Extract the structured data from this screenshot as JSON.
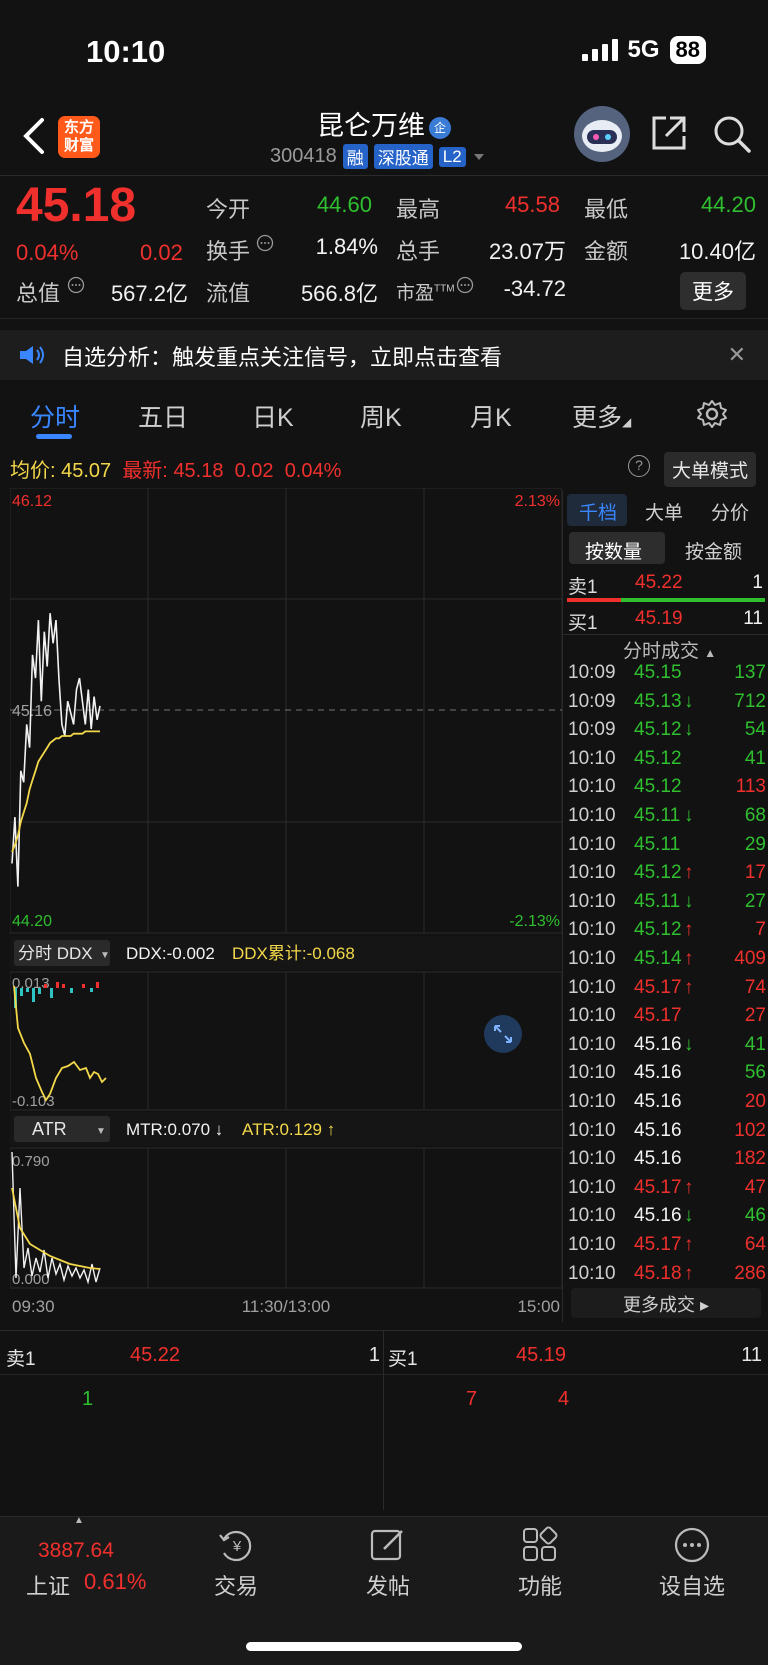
{
  "status_bar": {
    "time": "10:10",
    "network": "5G",
    "battery": "88"
  },
  "header": {
    "logo_text": "东方财富",
    "stock_name": "昆仑万维",
    "name_badge": "企",
    "stock_code": "300418",
    "tags": [
      "融",
      "深股通",
      "L2"
    ]
  },
  "quote": {
    "price": "45.18",
    "change_pct": "0.04%",
    "change_abs": "0.02",
    "fields": [
      {
        "label": "今开",
        "value": "44.60",
        "color": "green"
      },
      {
        "label": "最高",
        "value": "45.58",
        "color": "red"
      },
      {
        "label": "最低",
        "value": "44.20",
        "color": "green"
      },
      {
        "label": "换手",
        "value": "1.84%",
        "color": "white"
      },
      {
        "label": "总手",
        "value": "23.07万",
        "color": "white"
      },
      {
        "label": "金额",
        "value": "10.40亿",
        "color": "white"
      },
      {
        "label": "总值",
        "value": "567.2亿",
        "color": "white"
      },
      {
        "label": "流值",
        "value": "566.8亿",
        "color": "white"
      },
      {
        "label": "市盈",
        "value": "-34.72",
        "color": "white"
      }
    ],
    "pe_superscript": "TTM",
    "more_label": "更多"
  },
  "notice": {
    "text": "自选分析：触发重点关注信号，立即点击查看"
  },
  "tabs": [
    "分时",
    "五日",
    "日K",
    "周K",
    "月K",
    "更多"
  ],
  "avg_row": {
    "avg_label": "均价:",
    "avg_value": "45.07",
    "latest_label": "最新:",
    "latest_value": "45.18",
    "latest_chg": "0.02",
    "latest_pct": "0.04%",
    "big_order_btn": "大单模式"
  },
  "chart_labels": {
    "y_top": "46.12",
    "y_mid": "45.16",
    "y_bottom": "44.20",
    "pct_top": "2.13%",
    "pct_bottom": "-2.13%",
    "ddx_selector": "分时 DDX",
    "ddx_value": "DDX:-0.002",
    "ddx_cum": "DDX累计:-0.068",
    "ddx_top": "0.013",
    "ddx_bottom": "-0.103",
    "atr_selector": "ATR",
    "mtr_value": "MTR:0.070 ↓",
    "atr_value": "ATR:0.129 ↑",
    "atr_top": "0.790",
    "atr_bottom": "0.000",
    "t_start": "09:30",
    "t_mid": "11:30/13:00",
    "t_end": "15:00"
  },
  "chart_data": {
    "type": "line",
    "title": "",
    "xlabel": "",
    "ylabel": "",
    "ylim": [
      44.2,
      46.12
    ],
    "prev_close": 45.16,
    "x_range": [
      "09:30",
      "15:00"
    ],
    "series": [
      {
        "values": [
          44.5,
          44.7,
          44.4,
          44.9,
          44.85,
          45.1,
          45.0,
          45.4,
          45.3,
          45.55,
          45.2,
          45.5,
          45.35,
          45.58,
          45.45,
          45.55,
          45.3,
          45.1,
          45.05,
          45.2,
          45.15,
          45.1,
          45.25,
          45.3,
          45.2,
          45.1,
          45.25,
          45.08,
          45.22,
          45.12,
          45.18
        ]
      },
      {
        "values": [
          44.55,
          44.58,
          44.62,
          44.68,
          44.72,
          44.76,
          44.82,
          44.86,
          44.9,
          44.94,
          44.96,
          44.98,
          45.0,
          45.02,
          45.03,
          45.04,
          45.04,
          45.05,
          45.05,
          45.05,
          45.05,
          45.06,
          45.06,
          45.06,
          45.06,
          45.07,
          45.07,
          45.07,
          45.07,
          45.07,
          45.07
        ]
      }
    ]
  },
  "right_panel": {
    "tabs": [
      "千档",
      "大单",
      "分价"
    ],
    "sub_tabs": [
      "按数量",
      "按金额"
    ],
    "sell1": {
      "label": "卖1",
      "price": "45.22",
      "qty": "1"
    },
    "buy1": {
      "label": "买1",
      "price": "45.19",
      "qty": "11"
    },
    "ticks_header": "分时成交",
    "ticks": [
      {
        "time": "10:09",
        "price": "45.15",
        "arrow": "",
        "pc": "green",
        "vol": "137",
        "vc": "green"
      },
      {
        "time": "10:09",
        "price": "45.13",
        "arrow": "↓",
        "pc": "green",
        "vol": "712",
        "vc": "green"
      },
      {
        "time": "10:09",
        "price": "45.12",
        "arrow": "↓",
        "pc": "green",
        "vol": "54",
        "vc": "green"
      },
      {
        "time": "10:10",
        "price": "45.12",
        "arrow": "",
        "pc": "green",
        "vol": "41",
        "vc": "green"
      },
      {
        "time": "10:10",
        "price": "45.12",
        "arrow": "",
        "pc": "green",
        "vol": "113",
        "vc": "red"
      },
      {
        "time": "10:10",
        "price": "45.11",
        "arrow": "↓",
        "pc": "green",
        "vol": "68",
        "vc": "green"
      },
      {
        "time": "10:10",
        "price": "45.11",
        "arrow": "",
        "pc": "green",
        "vol": "29",
        "vc": "green"
      },
      {
        "time": "10:10",
        "price": "45.12",
        "arrow": "↑",
        "pc": "green",
        "vol": "17",
        "vc": "red"
      },
      {
        "time": "10:10",
        "price": "45.11",
        "arrow": "↓",
        "pc": "green",
        "vol": "27",
        "vc": "green"
      },
      {
        "time": "10:10",
        "price": "45.12",
        "arrow": "↑",
        "pc": "green",
        "vol": "7",
        "vc": "red"
      },
      {
        "time": "10:10",
        "price": "45.14",
        "arrow": "↑",
        "pc": "green",
        "vol": "409",
        "vc": "red"
      },
      {
        "time": "10:10",
        "price": "45.17",
        "arrow": "↑",
        "pc": "red",
        "vol": "74",
        "vc": "red"
      },
      {
        "time": "10:10",
        "price": "45.17",
        "arrow": "",
        "pc": "red",
        "vol": "27",
        "vc": "red"
      },
      {
        "time": "10:10",
        "price": "45.16",
        "arrow": "↓",
        "pc": "white",
        "vol": "41",
        "vc": "green"
      },
      {
        "time": "10:10",
        "price": "45.16",
        "arrow": "",
        "pc": "white",
        "vol": "56",
        "vc": "green"
      },
      {
        "time": "10:10",
        "price": "45.16",
        "arrow": "",
        "pc": "white",
        "vol": "20",
        "vc": "red"
      },
      {
        "time": "10:10",
        "price": "45.16",
        "arrow": "",
        "pc": "white",
        "vol": "102",
        "vc": "red"
      },
      {
        "time": "10:10",
        "price": "45.16",
        "arrow": "",
        "pc": "white",
        "vol": "182",
        "vc": "red"
      },
      {
        "time": "10:10",
        "price": "45.17",
        "arrow": "↑",
        "pc": "red",
        "vol": "47",
        "vc": "red"
      },
      {
        "time": "10:10",
        "price": "45.16",
        "arrow": "↓",
        "pc": "white",
        "vol": "46",
        "vc": "green"
      },
      {
        "time": "10:10",
        "price": "45.17",
        "arrow": "↑",
        "pc": "red",
        "vol": "64",
        "vc": "red"
      },
      {
        "time": "10:10",
        "price": "45.18",
        "arrow": "↑",
        "pc": "red",
        "vol": "286",
        "vc": "red"
      }
    ],
    "more_ticks": "更多成交"
  },
  "order_book": {
    "sell_label": "卖1",
    "sell_price": "45.22",
    "sell_qty": "1",
    "buy_label": "买1",
    "buy_price": "45.19",
    "buy_qty": "11",
    "sell_queue": [
      "1"
    ],
    "buy_queue": [
      "7",
      "4"
    ]
  },
  "bottom_nav": {
    "index_value": "3887.64",
    "index_name": "上证",
    "index_pct": "0.61%",
    "items": [
      "交易",
      "发帖",
      "功能",
      "设自选"
    ]
  },
  "colors": {
    "up": "#f0302d",
    "down": "#2fbf2f",
    "accent": "#3a86ff",
    "avg": "#f3d84a"
  }
}
